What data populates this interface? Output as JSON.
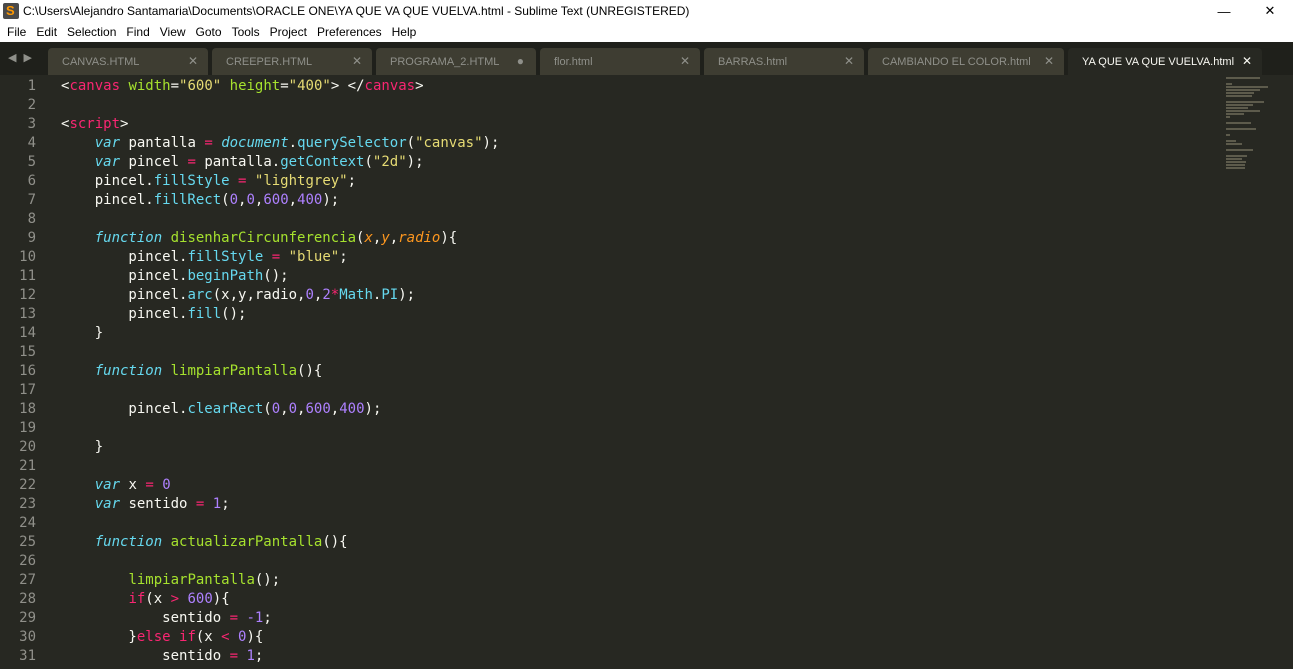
{
  "window": {
    "title": "C:\\Users\\Alejandro Santamaria\\Documents\\ORACLE ONE\\YA QUE VA QUE VUELVA.html - Sublime Text (UNREGISTERED)",
    "minimize": "—",
    "close": "✕"
  },
  "menu": [
    "File",
    "Edit",
    "Selection",
    "Find",
    "View",
    "Goto",
    "Tools",
    "Project",
    "Preferences",
    "Help"
  ],
  "tabs": [
    {
      "label": "CANVAS.HTML",
      "close": "✕",
      "dirty": false,
      "active": false
    },
    {
      "label": "CREEPER.HTML",
      "close": "✕",
      "dirty": false,
      "active": false
    },
    {
      "label": "PROGRAMA_2.HTML",
      "close": "●",
      "dirty": true,
      "active": false
    },
    {
      "label": "flor.html",
      "close": "✕",
      "dirty": false,
      "active": false
    },
    {
      "label": "BARRAS.html",
      "close": "✕",
      "dirty": false,
      "active": false
    },
    {
      "label": "CAMBIANDO EL COLOR.html",
      "close": "✕",
      "dirty": false,
      "active": false
    },
    {
      "label": "YA QUE VA QUE VUELVA.html",
      "close": "✕",
      "dirty": false,
      "active": true
    }
  ],
  "tab_nav_icons": "◀ ▶",
  "colors": {
    "background": "#272822",
    "fg": "#f8f8f2",
    "tag": "#f92672",
    "attr": "#a6e22e",
    "string": "#e6db74",
    "keyword": "#66d9ef",
    "number": "#ae81ff",
    "param": "#fd971f",
    "fn": "#a6e22e",
    "op": "#f92672"
  },
  "code_lines": [
    [
      [
        "<",
        "fg"
      ],
      [
        "canvas",
        "tag"
      ],
      [
        " ",
        "fg"
      ],
      [
        "width",
        "attr"
      ],
      [
        "=",
        "fg"
      ],
      [
        "\"600\"",
        "string"
      ],
      [
        " ",
        "fg"
      ],
      [
        "height",
        "attr"
      ],
      [
        "=",
        "fg"
      ],
      [
        "\"400\"",
        "string"
      ],
      [
        "> </",
        "fg"
      ],
      [
        "canvas",
        "tag"
      ],
      [
        ">",
        "fg"
      ]
    ],
    [],
    [
      [
        "<",
        "fg"
      ],
      [
        "script",
        "tag"
      ],
      [
        ">",
        "fg"
      ]
    ],
    [
      [
        "    ",
        "fg"
      ],
      [
        "var",
        "kwi"
      ],
      [
        " pantalla ",
        "fg"
      ],
      [
        "=",
        "op"
      ],
      [
        " ",
        "fg"
      ],
      [
        "document",
        "kwi"
      ],
      [
        ".",
        "fg"
      ],
      [
        "querySelector",
        "keyword"
      ],
      [
        "(",
        "fg"
      ],
      [
        "\"canvas\"",
        "string"
      ],
      [
        ");",
        "fg"
      ]
    ],
    [
      [
        "    ",
        "fg"
      ],
      [
        "var",
        "kwi"
      ],
      [
        " pincel ",
        "fg"
      ],
      [
        "=",
        "op"
      ],
      [
        " pantalla.",
        "fg"
      ],
      [
        "getContext",
        "keyword"
      ],
      [
        "(",
        "fg"
      ],
      [
        "\"2d\"",
        "string"
      ],
      [
        ");",
        "fg"
      ]
    ],
    [
      [
        "    pincel.",
        "fg"
      ],
      [
        "fillStyle",
        "keyword"
      ],
      [
        " ",
        "fg"
      ],
      [
        "=",
        "op"
      ],
      [
        " ",
        "fg"
      ],
      [
        "\"lightgrey\"",
        "string"
      ],
      [
        ";",
        "fg"
      ]
    ],
    [
      [
        "    pincel.",
        "fg"
      ],
      [
        "fillRect",
        "keyword"
      ],
      [
        "(",
        "fg"
      ],
      [
        "0",
        "number"
      ],
      [
        ",",
        "fg"
      ],
      [
        "0",
        "number"
      ],
      [
        ",",
        "fg"
      ],
      [
        "600",
        "number"
      ],
      [
        ",",
        "fg"
      ],
      [
        "400",
        "number"
      ],
      [
        ");",
        "fg"
      ]
    ],
    [],
    [
      [
        "    ",
        "fg"
      ],
      [
        "function",
        "kwi"
      ],
      [
        " ",
        "fg"
      ],
      [
        "disenharCircunferencia",
        "fn"
      ],
      [
        "(",
        "fg"
      ],
      [
        "x",
        "param"
      ],
      [
        ",",
        "fg"
      ],
      [
        "y",
        "param"
      ],
      [
        ",",
        "fg"
      ],
      [
        "radio",
        "param"
      ],
      [
        "){",
        "fg"
      ]
    ],
    [
      [
        "        pincel.",
        "fg"
      ],
      [
        "fillStyle",
        "keyword"
      ],
      [
        " ",
        "fg"
      ],
      [
        "=",
        "op"
      ],
      [
        " ",
        "fg"
      ],
      [
        "\"blue\"",
        "string"
      ],
      [
        ";",
        "fg"
      ]
    ],
    [
      [
        "        pincel.",
        "fg"
      ],
      [
        "beginPath",
        "keyword"
      ],
      [
        "();",
        "fg"
      ]
    ],
    [
      [
        "        pincel.",
        "fg"
      ],
      [
        "arc",
        "keyword"
      ],
      [
        "(x,y,radio,",
        "fg"
      ],
      [
        "0",
        "number"
      ],
      [
        ",",
        "fg"
      ],
      [
        "2",
        "number"
      ],
      [
        "*",
        "op"
      ],
      [
        "Math",
        "keyword"
      ],
      [
        ".",
        "fg"
      ],
      [
        "PI",
        "keyword"
      ],
      [
        ");",
        "fg"
      ]
    ],
    [
      [
        "        pincel.",
        "fg"
      ],
      [
        "fill",
        "keyword"
      ],
      [
        "();",
        "fg"
      ]
    ],
    [
      [
        "    }",
        "fg"
      ]
    ],
    [],
    [
      [
        "    ",
        "fg"
      ],
      [
        "function",
        "kwi"
      ],
      [
        " ",
        "fg"
      ],
      [
        "limpiarPantalla",
        "fn"
      ],
      [
        "(){",
        "fg"
      ]
    ],
    [],
    [
      [
        "        pincel.",
        "fg"
      ],
      [
        "clearRect",
        "keyword"
      ],
      [
        "(",
        "fg"
      ],
      [
        "0",
        "number"
      ],
      [
        ",",
        "fg"
      ],
      [
        "0",
        "number"
      ],
      [
        ",",
        "fg"
      ],
      [
        "600",
        "number"
      ],
      [
        ",",
        "fg"
      ],
      [
        "400",
        "number"
      ],
      [
        ");",
        "fg"
      ]
    ],
    [],
    [
      [
        "    }",
        "fg"
      ]
    ],
    [],
    [
      [
        "    ",
        "fg"
      ],
      [
        "var",
        "kwi"
      ],
      [
        " x ",
        "fg"
      ],
      [
        "=",
        "op"
      ],
      [
        " ",
        "fg"
      ],
      [
        "0",
        "number"
      ]
    ],
    [
      [
        "    ",
        "fg"
      ],
      [
        "var",
        "kwi"
      ],
      [
        " sentido ",
        "fg"
      ],
      [
        "=",
        "op"
      ],
      [
        " ",
        "fg"
      ],
      [
        "1",
        "number"
      ],
      [
        ";",
        "fg"
      ]
    ],
    [],
    [
      [
        "    ",
        "fg"
      ],
      [
        "function",
        "kwi"
      ],
      [
        " ",
        "fg"
      ],
      [
        "actualizarPantalla",
        "fn"
      ],
      [
        "(){",
        "fg"
      ]
    ],
    [],
    [
      [
        "        ",
        "fg"
      ],
      [
        "limpiarPantalla",
        "fn"
      ],
      [
        "();",
        "fg"
      ]
    ],
    [
      [
        "        ",
        "fg"
      ],
      [
        "if",
        "op"
      ],
      [
        "(x ",
        "fg"
      ],
      [
        ">",
        "op"
      ],
      [
        " ",
        "fg"
      ],
      [
        "600",
        "number"
      ],
      [
        "){",
        "fg"
      ]
    ],
    [
      [
        "            sentido ",
        "fg"
      ],
      [
        "=",
        "op"
      ],
      [
        " ",
        "fg"
      ],
      [
        "-1",
        "number"
      ],
      [
        ";",
        "fg"
      ]
    ],
    [
      [
        "        }",
        "fg"
      ],
      [
        "else",
        "op"
      ],
      [
        " ",
        "fg"
      ],
      [
        "if",
        "op"
      ],
      [
        "(x ",
        "fg"
      ],
      [
        "<",
        "op"
      ],
      [
        " ",
        "fg"
      ],
      [
        "0",
        "number"
      ],
      [
        "){",
        "fg"
      ]
    ],
    [
      [
        "            sentido ",
        "fg"
      ],
      [
        "=",
        "op"
      ],
      [
        " ",
        "fg"
      ],
      [
        "1",
        "number"
      ],
      [
        ";",
        "fg"
      ]
    ]
  ]
}
